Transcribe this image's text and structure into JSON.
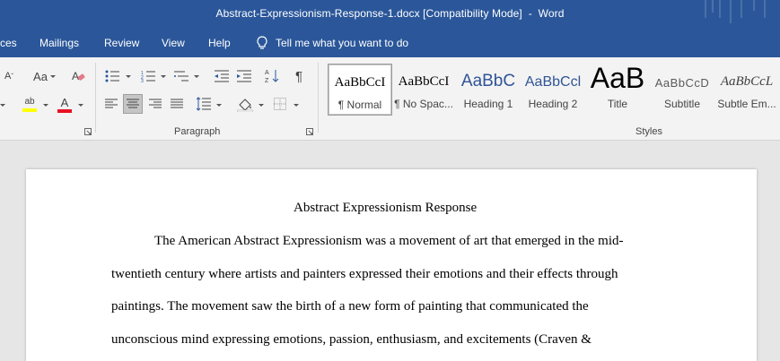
{
  "window": {
    "title": "Abstract-Expressionism-Response-1.docx [Compatibility Mode]  -  Word"
  },
  "menu": {
    "tabs": [
      "ces",
      "Mailings",
      "Review",
      "View",
      "Help"
    ],
    "tell_me": "Tell me what you want to do"
  },
  "ribbon": {
    "font_partial": {
      "case_label": "Aa",
      "font_color_label": "A",
      "highlight_label": "ab"
    },
    "paragraph_label": "Paragraph",
    "styles_label": "Styles",
    "styles": [
      {
        "preview": "AaBbCcI",
        "name": "¶ Normal"
      },
      {
        "preview": "AaBbCcI",
        "name": "¶ No Spac..."
      },
      {
        "preview": "AaBbC",
        "name": "Heading 1"
      },
      {
        "preview": "AaBbCcl",
        "name": "Heading 2"
      },
      {
        "preview": "AaB",
        "name": "Title"
      },
      {
        "preview": "AaBbCcD",
        "name": "Subtitle"
      },
      {
        "preview": "AaBbCcL",
        "name": "Subtle Em..."
      }
    ],
    "colors": {
      "font_color": "#e81123",
      "highlight": "#ffff00",
      "accent": "#2b579a"
    }
  },
  "document": {
    "title": "Abstract Expressionism Response",
    "lines": [
      "The American Abstract Expressionism was a movement of art that emerged in the mid-",
      "twentieth century where artists and painters expressed their emotions and their effects through",
      "paintings. The movement saw the birth of a new form of painting that communicated the",
      "unconscious mind expressing emotions, passion, enthusiasm, and excitements (Craven &"
    ]
  }
}
